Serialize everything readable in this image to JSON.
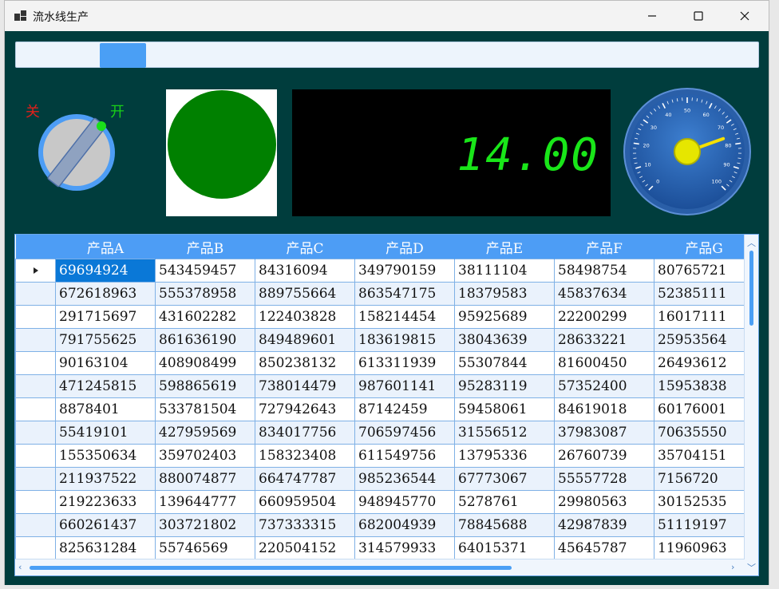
{
  "window": {
    "title": "流水线生产"
  },
  "progress": {
    "value_fraction": 0.12
  },
  "switch": {
    "off_label": "关",
    "on_label": "开",
    "state": "on"
  },
  "lamp": {
    "color": "#008000"
  },
  "lcd": {
    "value": "14.00",
    "color": "#19e619"
  },
  "gauge": {
    "ticks": [
      "0",
      "10",
      "20",
      "30",
      "40",
      "50",
      "60",
      "70",
      "80",
      "90",
      "100"
    ],
    "value": 76
  },
  "grid": {
    "columns": [
      "产品A",
      "产品B",
      "产品C",
      "产品D",
      "产品E",
      "产品F",
      "产品G"
    ],
    "rows": [
      [
        "69694924",
        "543459457",
        "84316094",
        "349790159",
        "38111104",
        "58498754",
        "80765721"
      ],
      [
        "672618963",
        "555378958",
        "889755664",
        "863547175",
        "18379583",
        "45837634",
        "52385111"
      ],
      [
        "291715697",
        "431602282",
        "122403828",
        "158214454",
        "95925689",
        "22200299",
        "16017111"
      ],
      [
        "791755625",
        "861636190",
        "849489601",
        "183619815",
        "38043639",
        "28633221",
        "25953564"
      ],
      [
        "90163104",
        "408908499",
        "850238132",
        "613311939",
        "55307844",
        "81600450",
        "26493612"
      ],
      [
        "471245815",
        "598865619",
        "738014479",
        "987601141",
        "95283119",
        "57352400",
        "15953838"
      ],
      [
        "8878401",
        "533781504",
        "727942643",
        "87142459",
        "59458061",
        "84619018",
        "60176001"
      ],
      [
        "55419101",
        "427959569",
        "834017756",
        "706597456",
        "31556512",
        "37983087",
        "70635550"
      ],
      [
        "155350634",
        "359702403",
        "158323408",
        "611549756",
        "13795336",
        "26760739",
        "35704151"
      ],
      [
        "211937522",
        "880074877",
        "664747787",
        "985236544",
        "67773067",
        "55557728",
        "7156720"
      ],
      [
        "219223633",
        "139644777",
        "660959504",
        "948945770",
        "5278761",
        "29980563",
        "30152535"
      ],
      [
        "660261437",
        "303721802",
        "737333315",
        "682004939",
        "78845688",
        "42987839",
        "51119197"
      ],
      [
        "825631284",
        "55746569",
        "220504152",
        "314579933",
        "64015371",
        "45645787",
        "11960963"
      ]
    ]
  }
}
